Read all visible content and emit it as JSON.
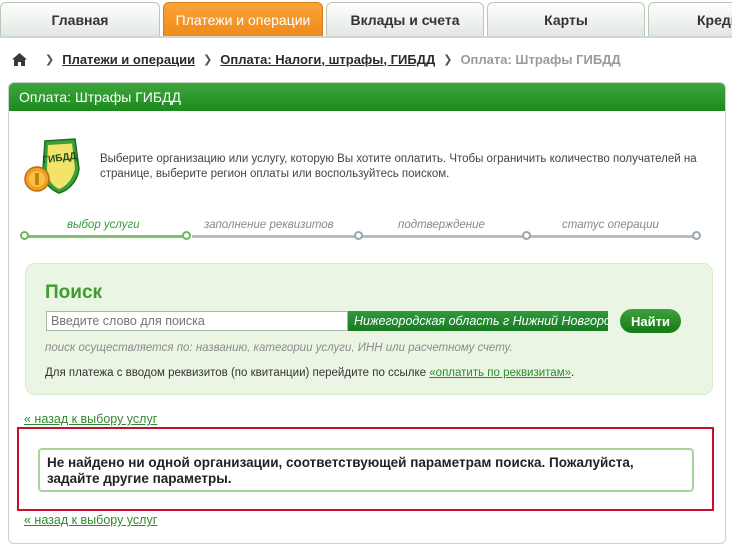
{
  "nav": {
    "tabs": [
      {
        "label": "Главная"
      },
      {
        "label": "Платежи и операции"
      },
      {
        "label": "Вклады и счета"
      },
      {
        "label": "Карты"
      },
      {
        "label": "Креди"
      }
    ],
    "active_tab": 1
  },
  "breadcrumb": {
    "items": [
      "Платежи и операции",
      "Оплата: Налоги, штрафы, ГИБДД"
    ],
    "current": "Оплата: Штрафы ГИБДД"
  },
  "panel": {
    "title": "Оплата: Штрафы ГИБДД",
    "logo_text": "ГИБДД",
    "intro": "Выберите организацию или услугу, которую Вы хотите оплатить. Чтобы ограничить количество получателей на странице, выберите регион оплаты или воспользуйтесь поиском."
  },
  "steps": {
    "labels": [
      "выбор услуги",
      "заполнение реквизитов",
      "подтверждение",
      "статус операции"
    ],
    "active_index": 0
  },
  "search": {
    "title": "Поиск",
    "placeholder": "Введите слово для поиска",
    "region": "Нижегородская область г Нижний Новгород",
    "button": "Найти",
    "hint": "поиск осуществляется по: названию, категории услуги, ИНН или расчетному счету.",
    "requisites_text": "Для платежа с вводом реквизитов (по квитанции) перейдите по ссылке",
    "requisites_link": "«оплатить по реквизитам»",
    "requisites_end": "."
  },
  "back_link": "« назад к выбору услуг",
  "error": {
    "message": "Не найдено ни одной организации, соответствующей параметрам поиска. Пожалуйста, задайте другие параметры."
  },
  "colors": {
    "brand_green": "#1d8a1d",
    "active_tab_orange": "#f08a1a",
    "error_frame_red": "#c8102e"
  }
}
